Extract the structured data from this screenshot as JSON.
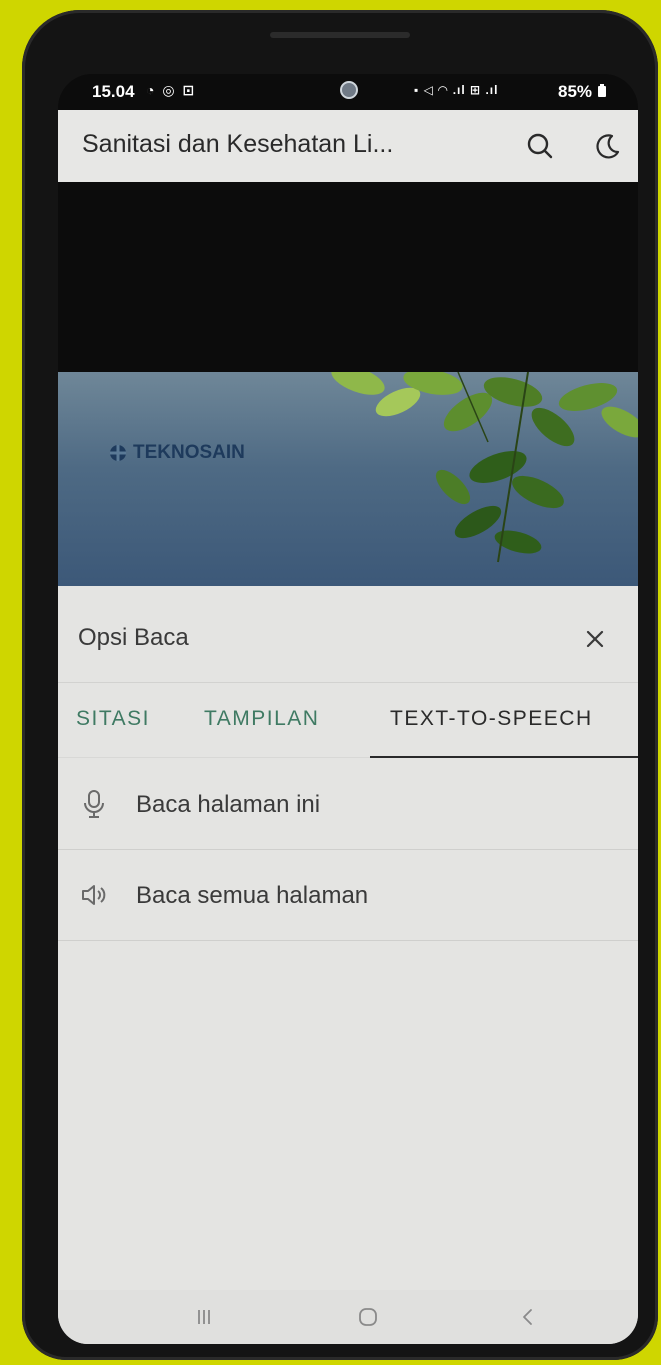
{
  "status_bar": {
    "time": "15.04",
    "left_icons": "◔ ◎ ⊡",
    "right_icons": "▪ ◁ ◠ .ıl ⊞ .ıl",
    "battery": "85%"
  },
  "app_bar": {
    "title": "Sanitasi dan Kesehatan Li...",
    "search_icon": "search-icon",
    "theme_icon": "moon-icon"
  },
  "banner": {
    "brand": "TEKNOSAIN"
  },
  "sheet": {
    "title": "Opsi Baca",
    "close_icon": "close-icon",
    "tabs": [
      {
        "label": "SITASI",
        "active": false
      },
      {
        "label": "TAMPILAN",
        "active": false
      },
      {
        "label": "TEXT-TO-SPEECH",
        "active": true
      }
    ],
    "items": [
      {
        "label": "Baca halaman ini",
        "icon": "microphone-icon"
      },
      {
        "label": "Baca semua halaman",
        "icon": "speaker-icon"
      }
    ]
  },
  "colors": {
    "background": "#cfd600",
    "tab_inactive": "#3f7a63",
    "tab_active": "#2a2a2a",
    "sheet": "#e4e4e2"
  }
}
